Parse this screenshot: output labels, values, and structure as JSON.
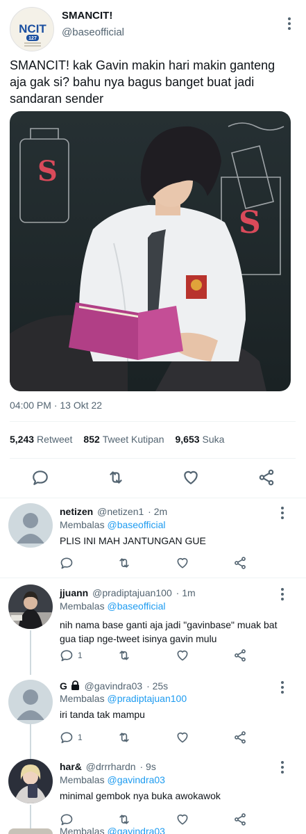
{
  "main_tweet": {
    "display_name": "SMANCIT!",
    "handle": "@baseofficial",
    "avatar_text": "NCIT",
    "avatar_badge": "127",
    "text": "SMANCIT! kak Gavin makin hari makin ganteng aja gak si? bahu nya bagus banget buat jadi sandaran sender",
    "timestamp": "04:00 PM · 13 Okt 22",
    "stats": {
      "retweets_count": "5,243",
      "retweets_label": "Retweet",
      "quotes_count": "852",
      "quotes_label": "Tweet Kutipan",
      "likes_count": "9,653",
      "likes_label": "Suka"
    },
    "icons": [
      "reply-icon",
      "retweet-icon",
      "like-icon",
      "share-icon"
    ]
  },
  "replies": [
    {
      "name": "netizen",
      "handle": "@netizen1",
      "time": "· 2m",
      "replying_label": "Membalas",
      "replying_to": "@baseofficial",
      "text": "PLIS INI MAH JANTUNGAN GUE",
      "reply_count": "",
      "avatar": "default-avatar"
    },
    {
      "name": "jjuann",
      "handle": "@pradiptajuan100",
      "time": "· 1m",
      "replying_label": "Membalas",
      "replying_to": "@baseofficial",
      "text": "nih nama base ganti aja jadi \"gavinbase\" muak bat gua tiap nge-tweet isinya gavin mulu",
      "reply_count": "1",
      "avatar": "photo-avatar"
    },
    {
      "name": "G",
      "handle": "@gavindra03",
      "time": "· 25s",
      "replying_label": "Membalas",
      "replying_to": "@pradiptajuan100",
      "text": "iri tanda tak mampu",
      "reply_count": "1",
      "avatar": "default-avatar",
      "locked": true
    },
    {
      "name": "har&",
      "handle": "@drrrhardn",
      "time": "· 9s",
      "replying_label": "Membalas",
      "replying_to": "@gavindra03",
      "text": "minimal gembok nya buka awokawok",
      "reply_count": "",
      "avatar": "photo-avatar"
    }
  ],
  "partial_next": {
    "replying_label": "Membalas",
    "replying_to": "@gavindra03"
  },
  "colors": {
    "accent": "#1d9bf0",
    "secondary_text": "#536471",
    "divider": "#eff3f4"
  }
}
